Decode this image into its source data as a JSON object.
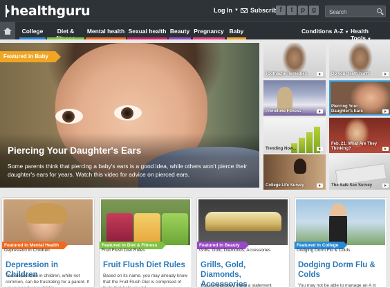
{
  "header": {
    "logo_text": "healthguru",
    "login_label": "Log In",
    "subscribe_label": "Subscribe",
    "social_icons": [
      "facebook-icon",
      "twitter-icon",
      "pinterest-icon",
      "google-plus-icon"
    ],
    "search_placeholder": "Search"
  },
  "nav": {
    "items": [
      {
        "label": "College",
        "color": "#2a8ad6"
      },
      {
        "label": "Diet & fitness",
        "color": "#7fc241"
      },
      {
        "label": "Mental health",
        "color": "#ef6a1f"
      },
      {
        "label": "Sexual health",
        "color": "#d4236f"
      },
      {
        "label": "Beauty",
        "color": "#9a48c8"
      },
      {
        "label": "Pregnancy",
        "color": "#e63f8c"
      },
      {
        "label": "Baby",
        "color": "#f0a623"
      }
    ],
    "conditions_label": "Conditions A-Z",
    "health_tools_label": "Health Tools"
  },
  "hero": {
    "tag": "Featured in Baby",
    "tag_color": "#f0a623",
    "title": "Piercing Your Daughter's Ears",
    "description": "Some parents think that piercing a baby's ears is a good idea, while others won't pierce their daughter's ears for years. Watch this video for advice on pierced ears."
  },
  "thumbnails": [
    {
      "caption": "Toothache Remedies"
    },
    {
      "caption": "Do your teeth hurt?"
    },
    {
      "caption": "Primetime Fitness"
    },
    {
      "caption": "Piercing Your Daughter's Ears"
    },
    {
      "caption": "Trending Now..."
    },
    {
      "caption": "Feb. 21: What Are They Thinking?"
    },
    {
      "caption": "College Life Survey"
    },
    {
      "caption": "The Safe Sex Survey"
    }
  ],
  "cards": [
    {
      "tag": "Featured in Mental Health",
      "tag_color": "#ef6a1f",
      "peek": "Depression in Children",
      "title": "Depression in Children",
      "text": "True depression in children, while not common, can be frustrating for a parent. If you suspect your child is"
    },
    {
      "tag": "Featured in Diet & Fitness",
      "tag_color": "#7fc241",
      "peek": "Fruit Flush Diet Rules",
      "title": "Fruit Flush Diet Rules",
      "text": "Based on its name, you may already know that the Fruit Flush Diet is comprised of fruits that help you rid"
    },
    {
      "tag": "Featured in Beauty",
      "tag_color": "#9a48c8",
      "peek": "Grills, Gold, Diamonds, Accessories",
      "title": "Grills, Gold, Diamonds, Accessories",
      "text": "You will definitely make a statement"
    },
    {
      "tag": "Featured in College",
      "tag_color": "#2a8ad6",
      "peek": "Dodging Dorm Flu & Colds",
      "title": "Dodging Dorm Flu & Colds",
      "text": "You may not be able to manage an A in"
    }
  ]
}
